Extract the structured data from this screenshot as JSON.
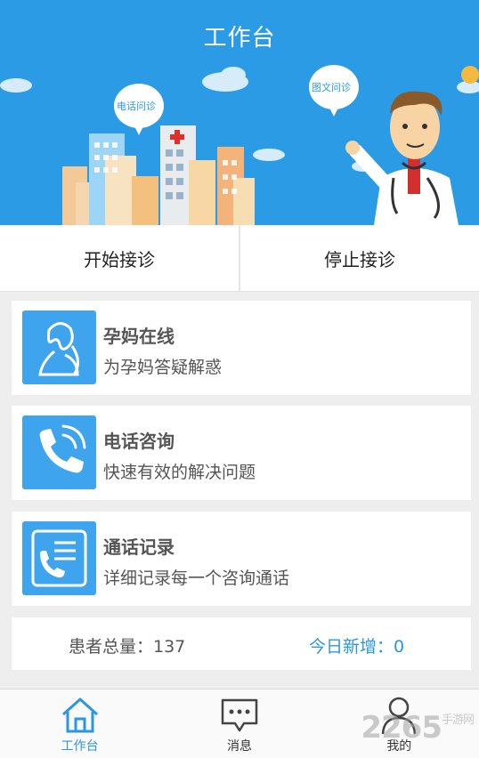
{
  "header": {
    "title": "工作台"
  },
  "banner": {
    "bubble_phone": "电话问诊",
    "bubble_text": "图文问诊"
  },
  "actions": {
    "start": "开始接诊",
    "stop": "停止接诊"
  },
  "cards": [
    {
      "title": "孕妈在线",
      "subtitle": "为孕妈答疑解惑",
      "icon": "pregnant-woman-icon"
    },
    {
      "title": "电话咨询",
      "subtitle": "快速有效的解决问题",
      "icon": "phone-icon"
    },
    {
      "title": "通话记录",
      "subtitle": "详细记录每一个咨询通话",
      "icon": "call-log-icon"
    }
  ],
  "stats": {
    "total_label": "患者总量：137",
    "today_label": "今日新增：0"
  },
  "nav": [
    {
      "label": "工作台",
      "icon": "home-icon",
      "active": true
    },
    {
      "label": "消息",
      "icon": "message-icon",
      "active": false
    },
    {
      "label": "我的",
      "icon": "user-icon",
      "active": false
    }
  ],
  "watermark": {
    "text": "2265",
    "sub": "手游网"
  },
  "colors": {
    "primary": "#2b9be6",
    "accent_text": "#2a97e0",
    "background": "#eeeeee"
  }
}
